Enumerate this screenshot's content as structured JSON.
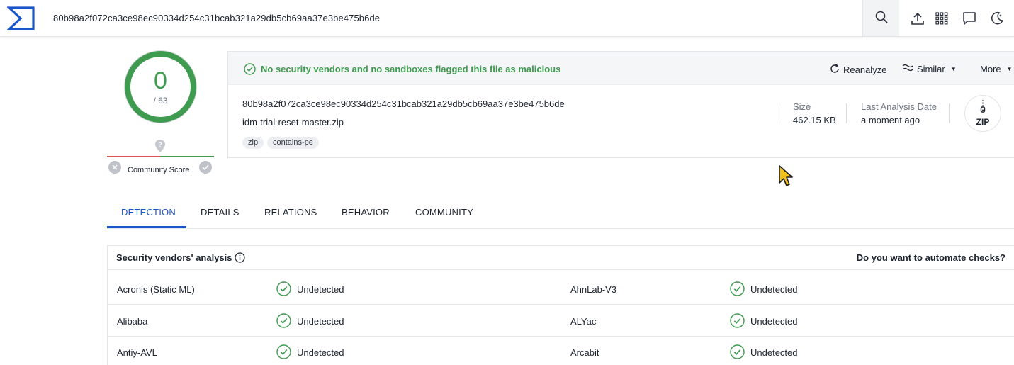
{
  "topbar": {
    "logo_icon": "virustotal-sigma-logo",
    "search_value": "80b98a2f072ca3ce98ec90334d254c31bcab321a29db5cb69aa37e3be475b6de",
    "icons": [
      "search-icon",
      "upload-icon",
      "apps-grid-icon",
      "chat-icon",
      "dark-mode-moon-icon"
    ]
  },
  "score": {
    "detections": "0",
    "total": "/ 63",
    "community_label": "Community Score"
  },
  "summary": {
    "status": "No security vendors and no sandboxes flagged this file as malicious",
    "actions": {
      "reanalyze": "Reanalyze",
      "similar": "Similar",
      "more": "More"
    },
    "hash": "80b98a2f072ca3ce98ec90334d254c31bcab321a29db5cb69aa37e3be475b6de",
    "filename": "idm-trial-reset-master.zip",
    "tags": [
      "zip",
      "contains-pe"
    ],
    "size_label": "Size",
    "size_value": "462.15 KB",
    "date_label": "Last Analysis Date",
    "date_value": "a moment ago",
    "file_type": "ZIP"
  },
  "tabs": [
    "DETECTION",
    "DETAILS",
    "RELATIONS",
    "BEHAVIOR",
    "COMMUNITY"
  ],
  "vendors": {
    "title": "Security vendors' analysis",
    "automate": "Do you want to automate checks?",
    "rows": [
      {
        "left": {
          "name": "Acronis (Static ML)",
          "result": "Undetected"
        },
        "right": {
          "name": "AhnLab-V3",
          "result": "Undetected"
        }
      },
      {
        "left": {
          "name": "Alibaba",
          "result": "Undetected"
        },
        "right": {
          "name": "ALYac",
          "result": "Undetected"
        }
      },
      {
        "left": {
          "name": "Antiy-AVL",
          "result": "Undetected"
        },
        "right": {
          "name": "Arcabit",
          "result": "Undetected"
        }
      }
    ]
  },
  "colors": {
    "accent": "#1a55c9",
    "clean": "#3e9b4f",
    "malicious": "#d9534f"
  }
}
